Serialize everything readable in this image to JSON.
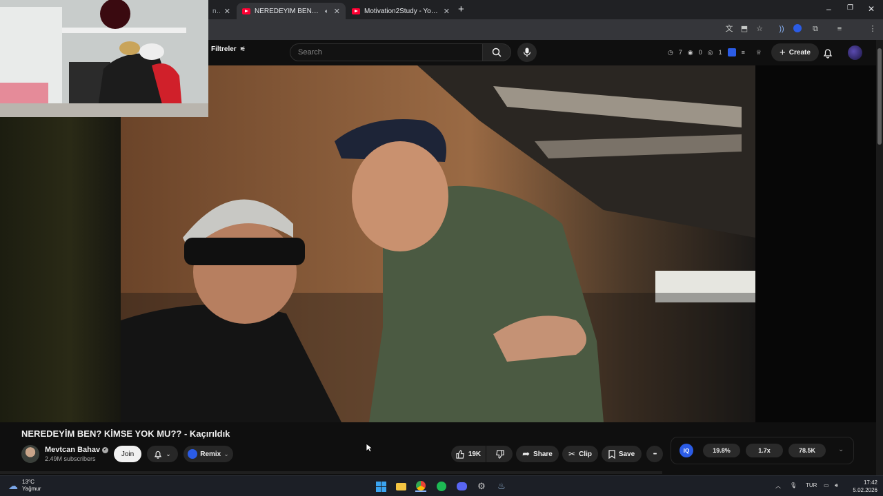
{
  "browser": {
    "tabs": [
      {
        "title": "n Re",
        "active": false
      },
      {
        "title": "NEREDEYİM BEN? KİMSE YOK MU?? - Kaçırıldık",
        "active": true
      },
      {
        "title": "Motivation2Study - YouTube",
        "active": false
      }
    ],
    "new_tab_label": "+",
    "window_controls": {
      "minimize": "–",
      "restore": "❐",
      "close": "✕"
    }
  },
  "youtube": {
    "filter_label": "Filtreler",
    "search_placeholder": "Search",
    "stats": {
      "views": "7",
      "eye": "0",
      "watch": "1"
    },
    "create_label": "Create"
  },
  "video": {
    "title": "NEREDEYİM BEN? KİMSE YOK MU?? - Kaçırıldık",
    "channel": {
      "name": "Mevtcan Bahav",
      "verified": true,
      "subscribers": "2.49M subscribers"
    },
    "join_label": "Join",
    "remix_label": "Remix",
    "likes": "19K",
    "share_label": "Share",
    "clip_label": "Clip",
    "save_label": "Save",
    "more_label": "•••"
  },
  "iq_panel": {
    "badge": "IQ",
    "values": [
      "19.8%",
      "1.7x",
      "78.5K"
    ]
  },
  "taskbar": {
    "weather": {
      "temp": "13°C",
      "condition": "Yağmur"
    },
    "language": "TUR",
    "time": "17:42",
    "date": "5.02.2026"
  },
  "colors": {
    "brand_red": "#ff0033",
    "iq_blue": "#2b5ce6",
    "background": "#0f0f0f"
  }
}
